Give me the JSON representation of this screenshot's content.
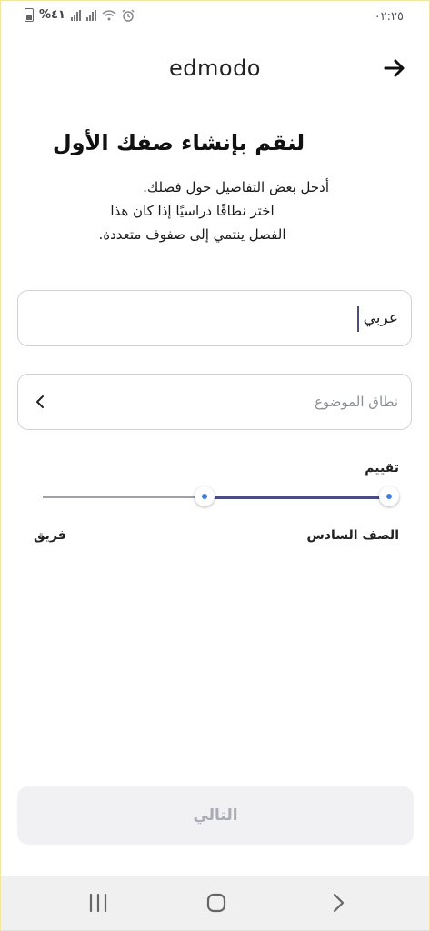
{
  "status_bar": {
    "time": "٠٢:٢٥",
    "battery": "%٤١"
  },
  "header": {
    "brand": "edmodo"
  },
  "headline": "لنقم بإنشاء صفك الأول",
  "description": [
    "أدخل بعض التفاصيل حول فصلك.",
    "اختر نطاقًا دراسيًا إذا كان هذا",
    "الفصل ينتمي إلى صفوف متعددة."
  ],
  "class_name": {
    "value": "عربي"
  },
  "subject": {
    "placeholder": "نطاق الموضوع"
  },
  "grade": {
    "label": "تقييم",
    "min_label": "الصف السادس",
    "max_label": "فريق",
    "selected_range_fraction": [
      0.0,
      0.55
    ]
  },
  "next_button": {
    "label": "التالي",
    "enabled": false
  },
  "icons": {
    "back": "arrow-right-icon",
    "chevron": "chevron-left-icon",
    "nav_recents": "recent-apps-icon",
    "nav_home": "home-icon",
    "nav_back": "nav-back-icon"
  }
}
